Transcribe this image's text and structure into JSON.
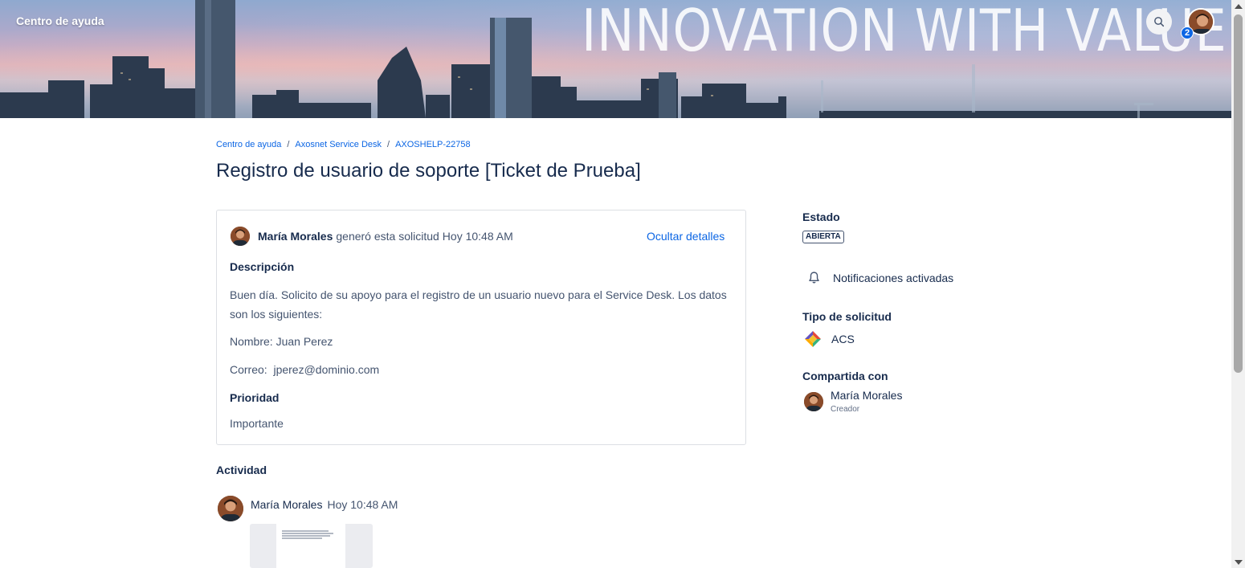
{
  "header": {
    "brand_label": "Centro de ayuda",
    "banner_slogan": "INNOVATION WITH VALUE",
    "notification_count": "2",
    "search_icon": "search-icon"
  },
  "breadcrumb": {
    "items": [
      "Centro de ayuda",
      "Axosnet Service Desk",
      "AXOSHELP-22758"
    ],
    "separator": "/"
  },
  "request": {
    "title": "Registro de usuario de soporte [Ticket de Prueba]",
    "reporter": "María Morales",
    "action_text": "generó esta solicitud",
    "timestamp": "Hoy 10:48 AM",
    "toggle_details_label": "Ocultar detalles",
    "description_label": "Descripción",
    "description_text": "Buen día. Solicito de su apoyo para el registro de un usuario nuevo para el Service Desk. Los datos son los siguientes:",
    "name_line": "Nombre: Juan Perez",
    "email_line": "Correo:  jperez@dominio.com",
    "priority_label": "Prioridad",
    "priority_value": "Importante"
  },
  "activity": {
    "title": "Actividad",
    "items": [
      {
        "author": "María Morales",
        "time": "Hoy 10:48 AM"
      }
    ]
  },
  "sidebar": {
    "status_label": "Estado",
    "status_value": "ABIERTA",
    "notifications_label": "Notificaciones activadas",
    "request_type_label": "Tipo de solicitud",
    "request_type_value": "ACS",
    "shared_label": "Compartida con",
    "shared_name": "María Morales",
    "shared_role": "Creador"
  },
  "colors": {
    "link": "#0c66e4",
    "text_primary": "#172b4d",
    "text_secondary": "#44546f",
    "badge": "#0c66e4"
  }
}
